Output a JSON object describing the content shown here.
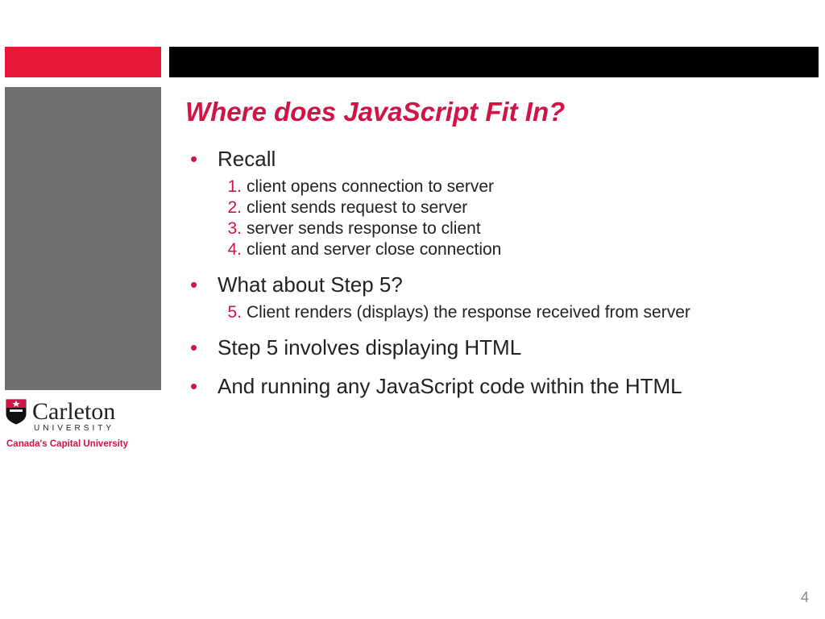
{
  "title": "Where does JavaScript Fit In?",
  "bullets": {
    "b1": "Recall",
    "steps1": [
      {
        "n": "1.",
        "t": "client opens connection to server"
      },
      {
        "n": "2.",
        "t": "client sends request to server"
      },
      {
        "n": "3.",
        "t": "server sends response to client"
      },
      {
        "n": "4.",
        "t": "client and server close connection"
      }
    ],
    "b2": "What about Step 5?",
    "steps2": [
      {
        "n": "5.",
        "t": "Client renders (displays) the response received from server"
      }
    ],
    "b3": "Step 5 involves displaying HTML",
    "b4": "And running any JavaScript code within the HTML"
  },
  "logo": {
    "name": "Carleton",
    "subtitle": "UNIVERSITY",
    "tagline": "Canada's Capital University"
  },
  "page_number": "4"
}
